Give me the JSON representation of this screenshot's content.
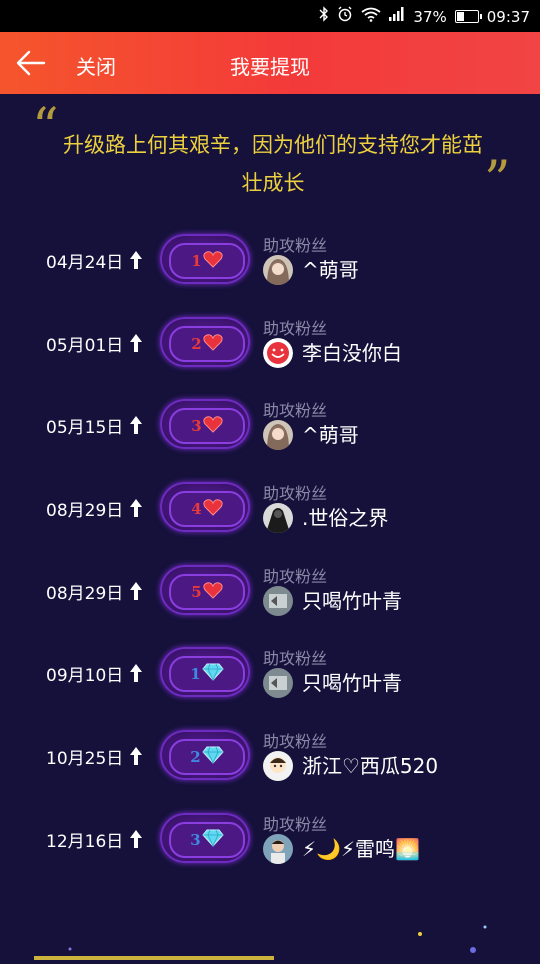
{
  "status_bar": {
    "battery": "37%",
    "time": "09:37",
    "battery_level": 0.37,
    "icons": [
      "bluetooth-icon",
      "alarm-icon",
      "wifi-icon",
      "signal-icon",
      "battery-icon"
    ]
  },
  "header": {
    "back_icon": "arrow-left-icon",
    "close_label": "关闭",
    "title": "我要提现",
    "bg_color": "#f33a3a"
  },
  "quote": {
    "open_mark": "“",
    "close_mark": "”",
    "text": "升级路上何其艰辛，因为他们的支持您才能茁壮成长",
    "color": "#ecd03e"
  },
  "rows": [
    {
      "date": "04月24日",
      "level": "1",
      "icon": "heart",
      "role": "助攻粉丝",
      "name": "^萌哥",
      "avatar": "photo-girl"
    },
    {
      "date": "05月01日",
      "level": "2",
      "icon": "heart",
      "role": "助攻粉丝",
      "name": "李白没你白",
      "avatar": "red-face"
    },
    {
      "date": "05月15日",
      "level": "3",
      "icon": "heart",
      "role": "助攻粉丝",
      "name": "^萌哥",
      "avatar": "photo-girl"
    },
    {
      "date": "08月29日",
      "level": "4",
      "icon": "heart",
      "role": "助攻粉丝",
      "name": ".世俗之界",
      "avatar": "dark-figure"
    },
    {
      "date": "08月29日",
      "level": "5",
      "icon": "heart",
      "role": "助攻粉丝",
      "name": "只喝竹叶青",
      "avatar": "gray-box"
    },
    {
      "date": "09月10日",
      "level": "1",
      "icon": "diamond",
      "role": "助攻粉丝",
      "name": "只喝竹叶青",
      "avatar": "gray-box"
    },
    {
      "date": "10月25日",
      "level": "2",
      "icon": "diamond",
      "role": "助攻粉丝",
      "name": "浙江♡西瓜520",
      "avatar": "cartoon"
    },
    {
      "date": "12月16日",
      "level": "3",
      "icon": "diamond",
      "role": "助攻粉丝",
      "name": "⚡🌙⚡雷鸣🌅",
      "avatar": "photo-boy"
    }
  ]
}
